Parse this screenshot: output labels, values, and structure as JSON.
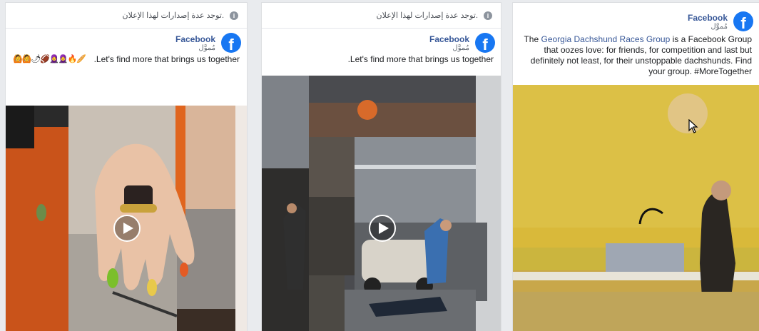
{
  "ads": [
    {
      "notice": "توجد عدة إصدارات لهذا الإعلان.",
      "page_name": "Facebook",
      "sponsored": "مُموَّل",
      "caption": "Let's find more that brings us together.",
      "emojis": "🙆🙆🌶🏈🧕🧕🔥🥖",
      "media_type": "video"
    },
    {
      "notice": "توجد عدة إصدارات لهذا الإعلان.",
      "page_name": "Facebook",
      "sponsored": "مُموَّل",
      "caption": "Let's find more that brings us together.",
      "media_type": "video"
    },
    {
      "page_name": "Facebook",
      "sponsored": "مُموَّل",
      "caption_pre": "The ",
      "caption_link": "Georgia Dachshund Races Group",
      "caption_post": " is a Facebook Group that oozes love: for friends, for competition and last but definitely not least, for their unstoppable dachshunds. Find your group. #MoreTogether",
      "media_type": "image"
    }
  ],
  "colors": {
    "brand": "#1877f2",
    "link": "#385898"
  },
  "icons": [
    "info-icon",
    "facebook-logo-icon",
    "play-icon",
    "mouse-cursor-icon"
  ]
}
